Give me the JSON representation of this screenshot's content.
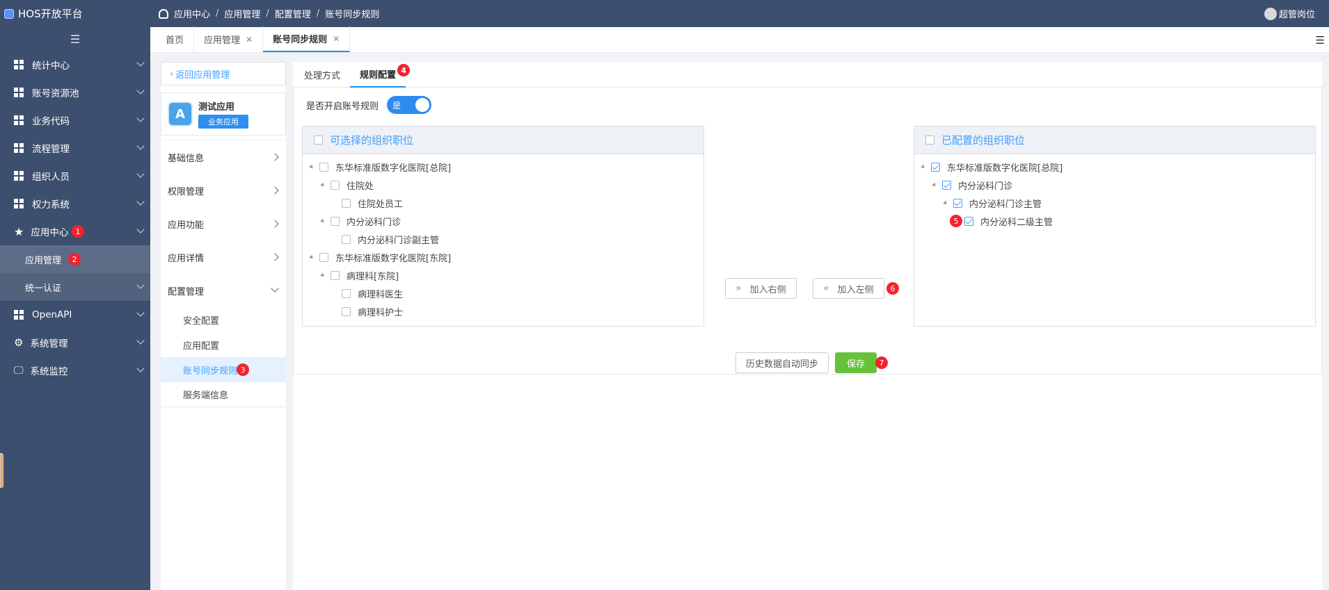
{
  "app": {
    "title": "HOS开放平台"
  },
  "header": {
    "breadcrumb": [
      "应用中心",
      "应用管理",
      "配置管理",
      "账号同步规则"
    ],
    "user": "超管岗位"
  },
  "sidebar": {
    "items": [
      {
        "label": "统计中心"
      },
      {
        "label": "账号资源池"
      },
      {
        "label": "业务代码"
      },
      {
        "label": "流程管理"
      },
      {
        "label": "组织人员"
      },
      {
        "label": "权力系统"
      },
      {
        "label": "应用中心",
        "badge": "1"
      },
      {
        "label": "应用管理",
        "badge": "2"
      },
      {
        "label": "统一认证"
      },
      {
        "label": "OpenAPI"
      },
      {
        "label": "系统管理"
      },
      {
        "label": "系统监控"
      }
    ]
  },
  "tabs": [
    {
      "label": "首页"
    },
    {
      "label": "应用管理"
    },
    {
      "label": "账号同步规则"
    }
  ],
  "left_panel": {
    "back": "返回应用管理",
    "app_name": "测试应用",
    "app_tag": "业务应用",
    "menu": [
      "基础信息",
      "权限管理",
      "应用功能",
      "应用详情",
      "配置管理"
    ],
    "sub_menu": [
      "安全配置",
      "应用配置",
      "账号同步规则",
      "服务端信息"
    ],
    "sub_badge": "3"
  },
  "main": {
    "tabs": [
      "处理方式",
      "规则配置"
    ],
    "tab_badge": "4",
    "switch_label": "是否开启账号规则",
    "switch_value": "是",
    "left_title": "可选择的组织职位",
    "right_title": "已配置的组织职位",
    "left_tree": [
      "东华标准版数字化医院[总院]",
      "住院处",
      "住院处员工",
      "内分泌科门诊",
      "内分泌科门诊副主管",
      "东华标准版数字化医院[东院]",
      "病理科[东院]",
      "病理科医生",
      "病理科护士"
    ],
    "right_tree": [
      "东华标准版数字化医院[总院]",
      "内分泌科门诊",
      "内分泌科门诊主管",
      "内分泌科二级主管"
    ],
    "right_badge": "5",
    "add_right": "加入右侧",
    "add_left": "加入左侧",
    "add_left_badge": "6",
    "history_btn": "历史数据自动同步",
    "save_btn": "保存",
    "save_badge": "7"
  }
}
